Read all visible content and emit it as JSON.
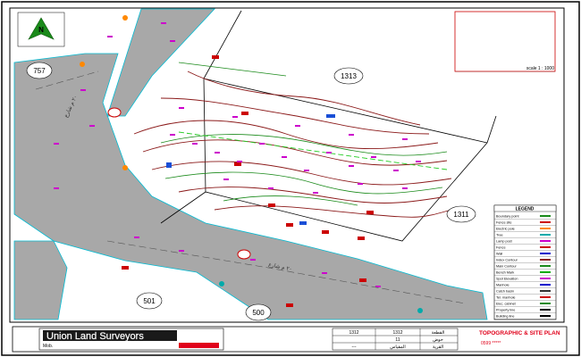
{
  "north_arrow": {
    "label": "N"
  },
  "parcels": {
    "p757": "757",
    "p1313": "1313",
    "p1311": "1311",
    "p501": "501",
    "p500": "500"
  },
  "roads": {
    "road_a": "٢٠ م شارع",
    "road_b": "٢٠ م شارع"
  },
  "scale": {
    "text": "scale 1 : 1000"
  },
  "legend": {
    "title": "LEGEND",
    "items": [
      {
        "label": "Boundary point",
        "color": "#1a8a1a"
      },
      {
        "label": "Fence site",
        "color": "#cc0000"
      },
      {
        "label": "Electric pole",
        "color": "#ff8800"
      },
      {
        "label": "Tree",
        "color": "#00aaaa"
      },
      {
        "label": "Lamp post",
        "color": "#cc00cc"
      },
      {
        "label": "Fence",
        "color": "#cc0000"
      },
      {
        "label": "Wall",
        "color": "#0000cc"
      },
      {
        "label": "Index Contour",
        "color": "#8b1a1a"
      },
      {
        "label": "Main Contour",
        "color": "#1a8a1a"
      },
      {
        "label": "Bench Mark",
        "color": "#00aa00"
      },
      {
        "label": "Spot Elevation",
        "color": "#cc00cc"
      },
      {
        "label": "Manhole",
        "color": "#0000cc"
      },
      {
        "label": "Catch basin",
        "color": "#333333"
      },
      {
        "label": "Tel. manhole",
        "color": "#cc0000"
      },
      {
        "label": "Elec. cabinet",
        "color": "#1a8a1a"
      },
      {
        "label": "Property line",
        "color": "#000000"
      },
      {
        "label": "Building line",
        "color": "#000000"
      }
    ]
  },
  "title_block": {
    "company": "Union Land Surveyors",
    "phone_label": "Mob.",
    "plan_title": "TOPOGRAPHIC & SITE PLAN",
    "plot_label": "القطعة",
    "plot_value": "1312",
    "parcel_label": "حوض",
    "parcel_value": "11",
    "village_label": "القرية",
    "sheet_label": "المقياس",
    "dash": "---",
    "number_left": "1312",
    "phone_number": "0599 *****"
  },
  "colors": {
    "road": "#a7a7a7",
    "frame": "#0a0a0a",
    "index_contour": "#8b1a1a",
    "main_contour": "#1a8a1a",
    "boundary": "#000000",
    "spot": "#cc00cc",
    "red_mark": "#cc0000",
    "title_red": "#e0001a"
  }
}
